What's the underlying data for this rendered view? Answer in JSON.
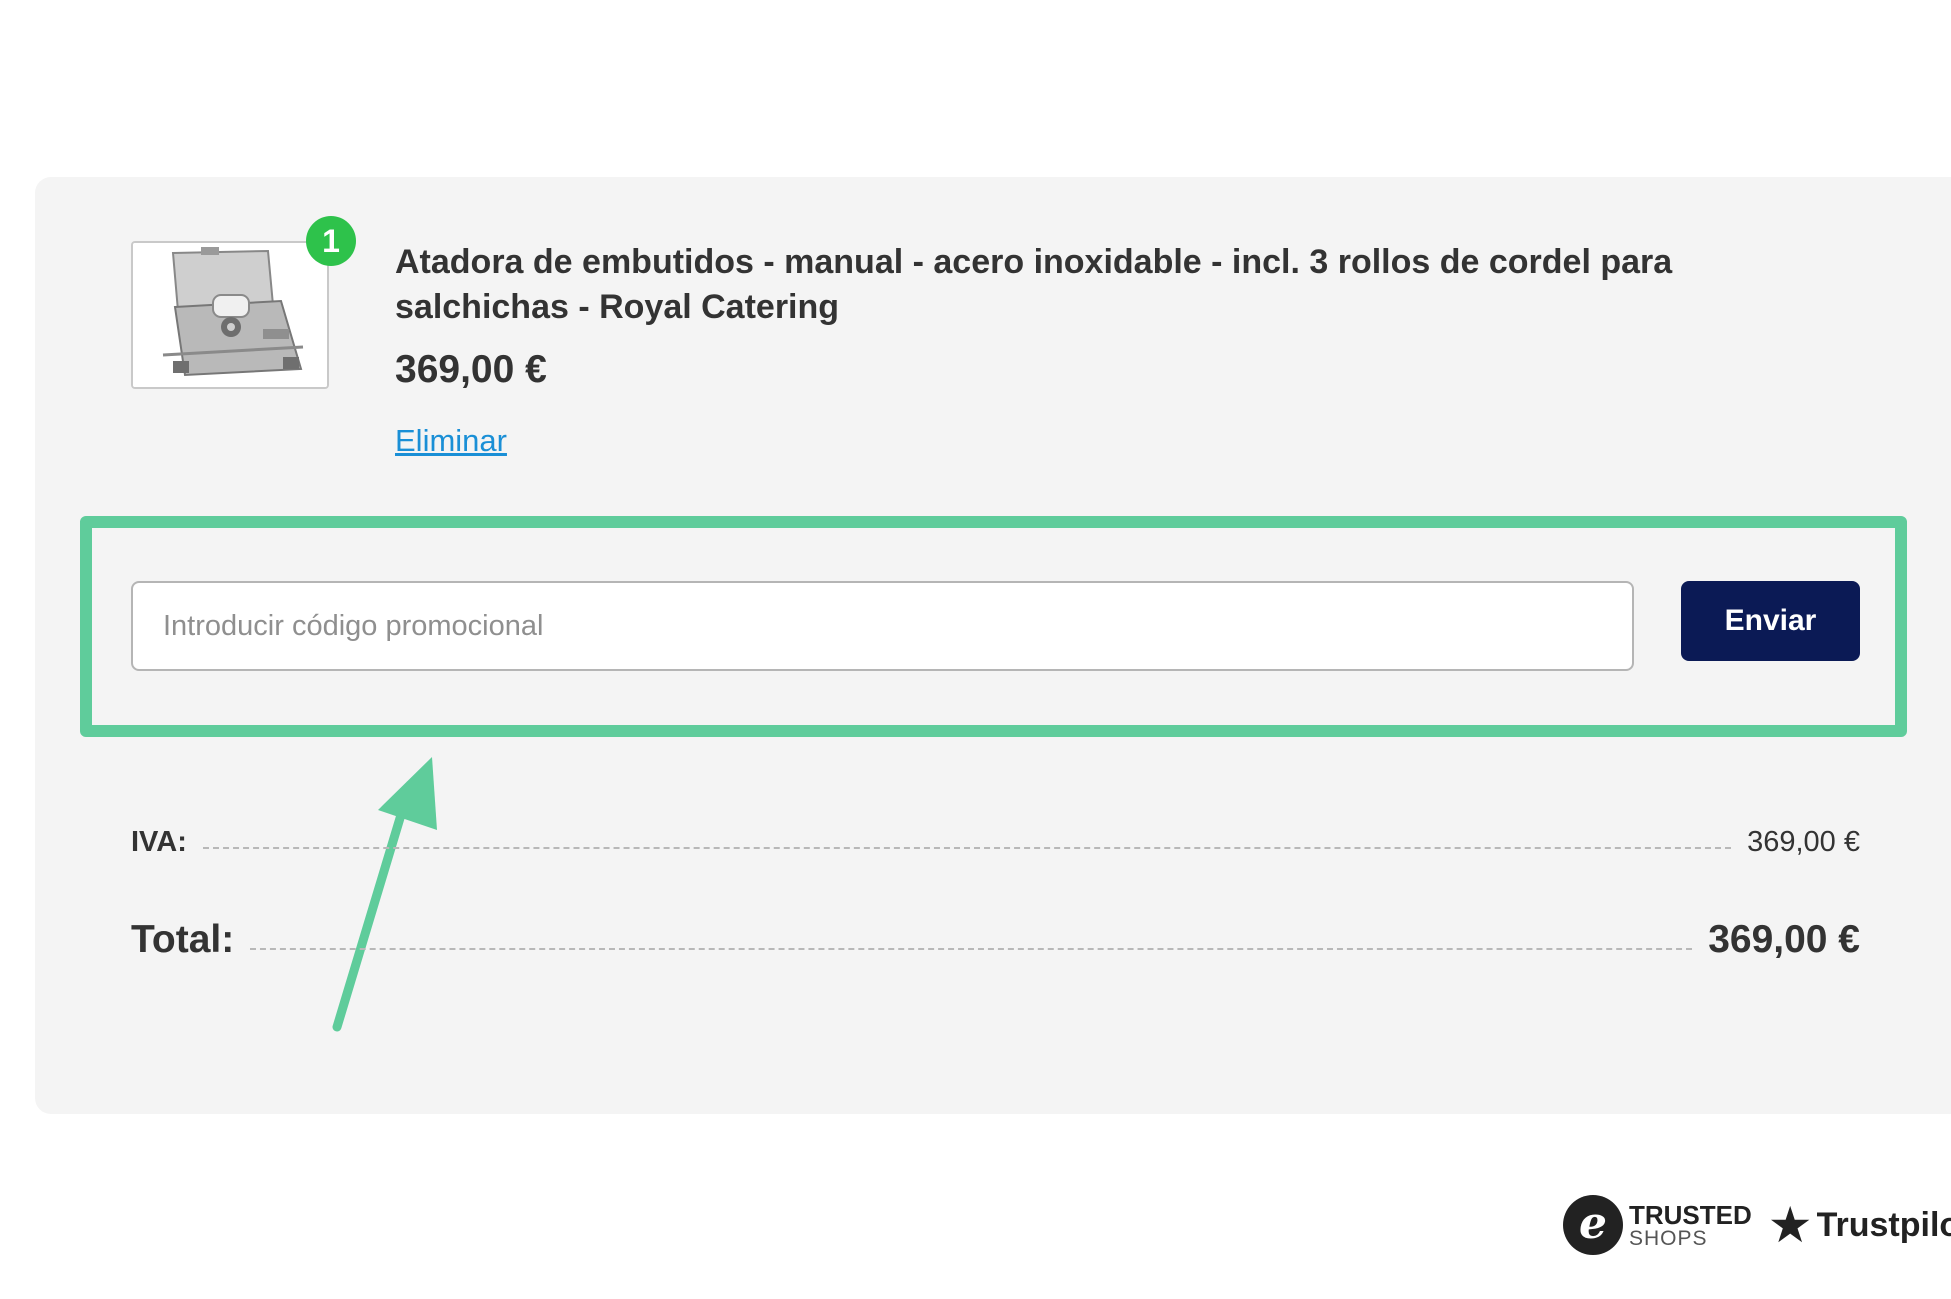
{
  "cart_item": {
    "quantity": "1",
    "title": "Atadora de embutidos - manual - acero inoxidable - incl. 3 rollos de cordel para salchichas - Royal Catering",
    "price": "369,00 €",
    "remove_label": "Eliminar"
  },
  "promo": {
    "placeholder": "Introducir código promocional",
    "value": "",
    "submit_label": "Enviar"
  },
  "summary": {
    "vat_label": "IVA:",
    "vat_value": "369,00 €",
    "total_label": "Total:",
    "total_value": "369,00 €"
  },
  "trust_badges": {
    "trusted_shops_icon_letter": "e",
    "trusted_shops_line1": "TRUSTED",
    "trusted_shops_line2": "SHOPS",
    "trustpilot_icon": "star-icon",
    "trustpilot_label": "Trustpilot"
  },
  "colors": {
    "panel_background": "#f4f4f4",
    "highlight_border": "#5fcc9b",
    "submit_button": "#0b1a55",
    "quantity_badge": "#2ec24b",
    "link": "#1a8fd6"
  }
}
